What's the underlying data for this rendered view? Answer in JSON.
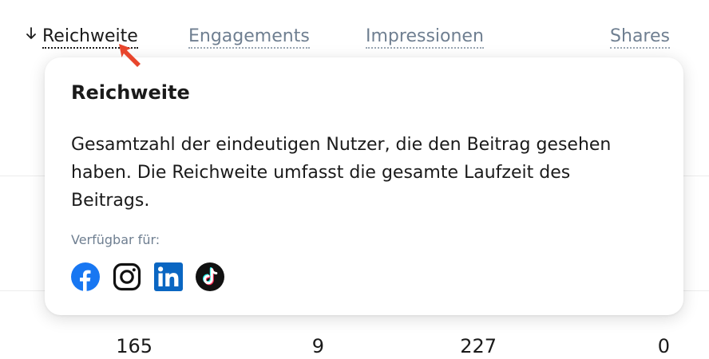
{
  "columns": {
    "reach": "Reichweite",
    "engagements": "Engagements",
    "impressions": "Impressionen",
    "shares": "Shares"
  },
  "tooltip": {
    "title": "Reichweite",
    "description": "Gesamtzahl der eindeutigen Nutzer, die den Beitrag gesehen haben. Die Reichweite umfasst die gesamte Laufzeit des Beitrags.",
    "available_label": "Verfügbar für:",
    "platforms": [
      "facebook-icon",
      "instagram-icon",
      "linkedin-icon",
      "tiktok-icon"
    ]
  },
  "row": {
    "reach": "165",
    "engagements": "9",
    "impressions": "227",
    "shares": "0"
  },
  "colors": {
    "facebook": "#1877F2",
    "linkedin": "#0A66C2",
    "cursor": "#E8452C",
    "muted": "#6F7F91"
  }
}
